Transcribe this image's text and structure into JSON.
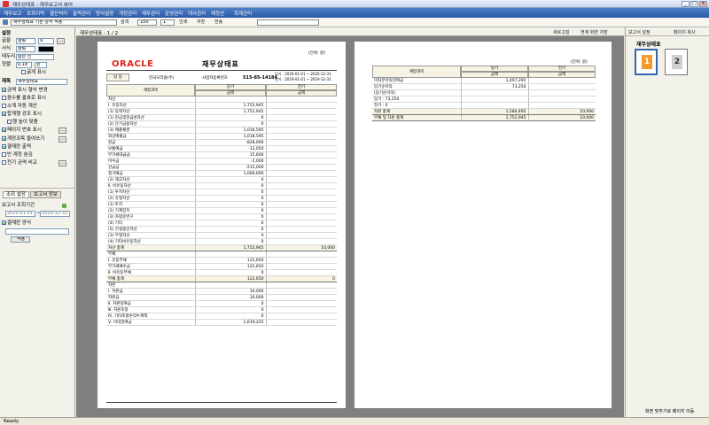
{
  "window": {
    "title": "재무상태표 - 재무보고서 뷰어"
  },
  "menu": [
    "재무보고",
    "조회이력",
    "결산처리",
    "출력관리",
    "양식설정",
    "개정관리",
    "재무관리",
    "운영관리",
    "대사관리",
    "재정산",
    "회계관리"
  ],
  "toolbar": {
    "field_company": "재무상태표 기본 양식 적용",
    "field_zoom": "100",
    "field_page": "1",
    "field_search": "",
    "btn_find": "검색",
    "btn_print": "인쇄",
    "btn_pdf": "저장",
    "btn_send": "전송"
  },
  "left": {
    "tab_title": "설정",
    "font_label": "글꼴",
    "font_value": "굴림",
    "font_size": "9",
    "format_label": "서식",
    "format_value": "굴림",
    "border_label": "테두리",
    "border_value": "얇은 선",
    "align_label": "정렬",
    "align_value": "0.18",
    "unit_value": "원",
    "opt_bold": "굵게 표시",
    "title_label": "제목",
    "title_value": "재무상태표",
    "checks": [
      {
        "label": "금액 표시 형식 변경",
        "on": true
      },
      {
        "label": "음수를 괄호로 표시",
        "on": false
      },
      {
        "label": "소계 자동 계산",
        "on": false
      },
      {
        "label": "합계행 강조 표시",
        "on": true
      },
      {
        "label": "행 높이 맞춤",
        "on": false
      },
      {
        "label": "페이지 번호 표시",
        "on": true
      },
      {
        "label": "계정과목 들여쓰기",
        "on": true
      },
      {
        "label": "결재란 출력",
        "on": true
      },
      {
        "label": "빈 계정 숨김",
        "on": false
      },
      {
        "label": "전기 금액 비교",
        "on": false
      }
    ],
    "tab1": "조회 설정",
    "tab2": "보고서 정보",
    "period_label": "보고서 조회기간",
    "date_from": "2020-01-01",
    "date_to": "2020-12-31",
    "sign_label": "결재란 양식",
    "sign_select": "",
    "btn_apply": "적용"
  },
  "viewer": {
    "page_label": "재무상태표 - 1 / 2"
  },
  "page1": {
    "logo": "ORACLE",
    "title": "재무상태표",
    "unit_note": "(단위: 원)",
    "stamp": "담 당",
    "company": "한국오라클(주)",
    "reg_label": "사업자등록번호",
    "reg_no": "515-85-14184",
    "period_cur": "당기 : 2020-01-01 ~ 2020-12-31",
    "period_prev": "전기 : 2019-01-01 ~ 2019-12-31",
    "col_account": "계정과목",
    "col_cur": "당기",
    "col_prev": "전기",
    "col_amount": "금액",
    "rows": [
      {
        "a": "자산",
        "c": "",
        "p": ""
      },
      {
        "a": "Ⅰ. 유동자산",
        "c": "1,752,945",
        "p": ""
      },
      {
        "a": "(1) 당좌자산",
        "c": "1,752,945",
        "p": ""
      },
      {
        "a": "(1) 현금및현금성자산",
        "c": "0",
        "p": ""
      },
      {
        "a": "(2) 단기금융자산",
        "c": "0",
        "p": ""
      },
      {
        "a": "(3) 매출채권",
        "c": "1,018,595",
        "p": ""
      },
      {
        "a": "외상매출금",
        "c": "1,018,595",
        "p": ""
      },
      {
        "a": "현금",
        "c": "-828,000",
        "p": ""
      },
      {
        "a": "보통예금",
        "c": "-12,050",
        "p": ""
      },
      {
        "a": "부가세대급금",
        "c": "15,600",
        "p": ""
      },
      {
        "a": "미수금",
        "c": "-2,000",
        "p": ""
      },
      {
        "a": "선급금",
        "c": "-215,000",
        "p": ""
      },
      {
        "a": "정기예금",
        "c": "1,000,000",
        "p": ""
      },
      {
        "a": "(2) 재고자산",
        "c": "0",
        "p": ""
      },
      {
        "a": "Ⅱ. 비유동자산",
        "c": "0",
        "p": ""
      },
      {
        "a": "(1) 투자자산",
        "c": "0",
        "p": ""
      },
      {
        "a": "(2) 유형자산",
        "c": "0",
        "p": ""
      },
      {
        "a": "(1) 토지",
        "c": "0",
        "p": ""
      },
      {
        "a": "(2) 기계장치",
        "c": "0",
        "p": ""
      },
      {
        "a": "(3) 차량운반구",
        "c": "0",
        "p": ""
      },
      {
        "a": "(4) 기타",
        "c": "0",
        "p": ""
      },
      {
        "a": "(5) 건설중인자산",
        "c": "0",
        "p": ""
      },
      {
        "a": "(3) 무형자산",
        "c": "0",
        "p": ""
      },
      {
        "a": "(4) 기타비유동자산",
        "c": "0",
        "p": ""
      },
      {
        "a": "자산 총계",
        "c": "1,752,945",
        "p": "10,000",
        "sum": true
      },
      {
        "a": "부채",
        "c": "",
        "p": ""
      },
      {
        "a": "Ⅰ. 유동부채",
        "c": "122,650",
        "p": ""
      },
      {
        "a": "부가세예수금",
        "c": "122,650",
        "p": ""
      },
      {
        "a": "Ⅱ. 비유동부채",
        "c": "0",
        "p": ""
      },
      {
        "a": "부채 총계",
        "c": "122,650",
        "p": "0",
        "sum": true
      },
      {
        "a": "자본",
        "c": "",
        "p": ""
      },
      {
        "a": "Ⅰ. 자본금",
        "c": "10,000",
        "p": ""
      },
      {
        "a": "자본금",
        "c": "10,000",
        "p": ""
      },
      {
        "a": "Ⅱ. 자본잉여금",
        "c": "0",
        "p": ""
      },
      {
        "a": "Ⅲ. 자본조정",
        "c": "0",
        "p": ""
      },
      {
        "a": "Ⅳ. 기타포괄손익누계액",
        "c": "0",
        "p": ""
      },
      {
        "a": "Ⅴ. 이익잉여금",
        "c": "1,619,225",
        "p": ""
      }
    ]
  },
  "page2": {
    "unit_note": "(단위: 원)",
    "col_account": "계정과목",
    "col_cur": "당기",
    "col_prev": "전기",
    "col_amount": "금액",
    "rows": [
      {
        "a": "미처분이익잉여금",
        "c": "1,497,295",
        "p": ""
      },
      {
        "a": "당기순이익",
        "c": "73,250",
        "p": ""
      },
      {
        "a": "(당기순이익)",
        "c": "",
        "p": ""
      },
      {
        "a": "당기 : 73,250",
        "c": "",
        "p": ""
      },
      {
        "a": "전기 : 0",
        "c": "",
        "p": ""
      },
      {
        "a": "자본 총계",
        "c": "1,580,495",
        "p": "10,000",
        "sum": true
      },
      {
        "a": "부채 및 자본 총계",
        "c": "1,752,945",
        "p": "10,000",
        "sum": true
      }
    ]
  },
  "right": {
    "btn1": "새로고침",
    "btn2": "현재 화면 저장",
    "btn3": "보고서 설정",
    "btn4": "페이지 복사",
    "thumbs_title": "재무상태표",
    "thumb1": "1",
    "thumb2": "2",
    "footer": "화면 맞추기로 페이지 이동"
  },
  "status": {
    "text": "Ready"
  }
}
